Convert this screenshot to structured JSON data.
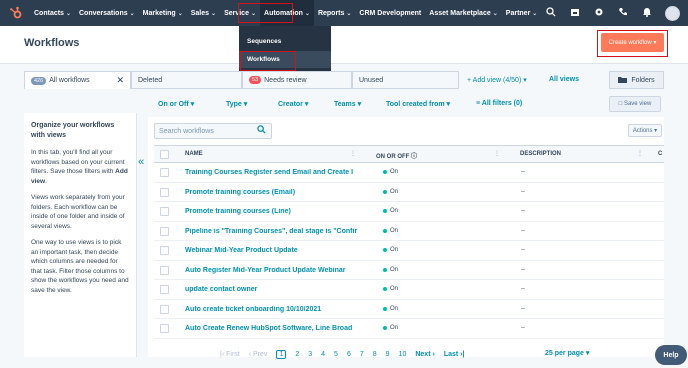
{
  "nav": {
    "items": [
      "Contacts",
      "Conversations",
      "Marketing",
      "Sales",
      "Service",
      "Automation",
      "Reports",
      "CRM Development",
      "Asset Marketplace",
      "Partner"
    ],
    "active": "Automation"
  },
  "dropdown": {
    "items": [
      "Sequences",
      "Workflows"
    ],
    "selected": "Workflows"
  },
  "page": {
    "title": "Workflows",
    "create_button": "Create workflow ▾"
  },
  "tabs": [
    {
      "count": "426",
      "label": "All workflows",
      "close": "✕"
    },
    {
      "count": "",
      "label": "Deleted"
    },
    {
      "count": "53",
      "label": "Needs review"
    },
    {
      "count": "",
      "label": "Unused"
    }
  ],
  "views": {
    "add_view": "+ Add view (4/50) ▾",
    "all_views": "All views",
    "folders": "Folders"
  },
  "filters": {
    "on_or_off": "On or Off ▾",
    "type": "Type ▾",
    "creator": "Creator ▾",
    "teams": "Teams ▾",
    "tool_created_from": "Tool created from ▾",
    "all_filters": "All filters (0)",
    "save_view": "Save view"
  },
  "info_panel": {
    "title": "Organize your workflows with views",
    "p1": "In this tab, you'll find all your workflows based on your current filters. Save those filters with Add view.",
    "p2": "Views work separately from your folders. Each workflow can be inside of one folder and inside of several views.",
    "p3": "One way to use views is to pick an important task, then decide which columns are needed for that task. Filter those columns to show the workflows you need and save the view."
  },
  "table": {
    "search_placeholder": "Search workflows",
    "actions": "Actions ▾",
    "columns": [
      "NAME",
      "ON OR OFF",
      "DESCRIPTION",
      "C"
    ],
    "rows": [
      {
        "name": "Training Courses Register send Email and Create I",
        "status": "On",
        "description": "--"
      },
      {
        "name": "Promote training courses (Email)",
        "status": "On",
        "description": "--"
      },
      {
        "name": "Promote training courses (Line)",
        "status": "On",
        "description": "--"
      },
      {
        "name": "Pipeline is \"Training Courses\", deal stage is \"Confir",
        "status": "On",
        "description": "--"
      },
      {
        "name": "Webinar Mid-Year Product Update",
        "status": "On",
        "description": "--"
      },
      {
        "name": "Auto Register Mid-Year Product Update Webinar",
        "status": "On",
        "description": "--"
      },
      {
        "name": "update contact owner",
        "status": "On",
        "description": "--"
      },
      {
        "name": "Auto create ticket onboarding 10/10/2021",
        "status": "On",
        "description": "--"
      },
      {
        "name": "Auto Create Renew HubSpot Software, Line Broad",
        "status": "On",
        "description": "--"
      }
    ]
  },
  "pagination": {
    "first": "First",
    "prev": "Prev",
    "pages": [
      "1",
      "2",
      "3",
      "4",
      "5",
      "6",
      "7",
      "8",
      "9",
      "10"
    ],
    "current": "1",
    "next": "Next",
    "last": "Last",
    "per_page": "25 per page ▾"
  },
  "help": "Help",
  "colors": {
    "nav_bg": "#2d3e50",
    "accent": "#0091ae",
    "orange": "#ff7a59",
    "highlight": "#d0121a",
    "status_on": "#00bda5"
  }
}
